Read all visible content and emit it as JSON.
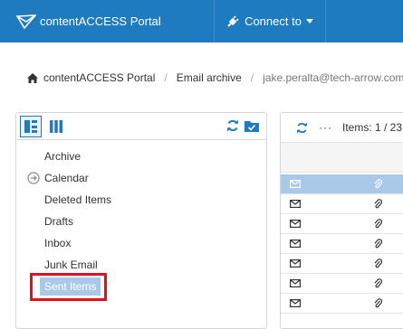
{
  "header": {
    "brand": "contentACCESS Portal",
    "connect_label": "Connect to",
    "brand_color": "#1f7bbf"
  },
  "breadcrumb": {
    "items": [
      "contentACCESS Portal",
      "Email archive",
      "jake.peralta@tech-arrow.com"
    ]
  },
  "folders": {
    "items": [
      {
        "label": "Archive",
        "expandable": false
      },
      {
        "label": "Calendar",
        "expandable": true
      },
      {
        "label": "Deleted Items",
        "expandable": false
      },
      {
        "label": "Drafts",
        "expandable": false
      },
      {
        "label": "Inbox",
        "expandable": false
      },
      {
        "label": "Junk Email",
        "expandable": false
      },
      {
        "label": "Sent Items",
        "expandable": false,
        "selected": true
      }
    ],
    "selected_color": "#aac9e8",
    "highlight_color": "#e0101e"
  },
  "mail": {
    "items_label": "Items: 1 / 23",
    "more_label": "···"
  },
  "icons": [
    "logo-icon",
    "plug-icon",
    "caret-down-icon",
    "home-icon",
    "tree-view-icon",
    "column-view-icon",
    "refresh-icon",
    "folder-check-icon",
    "circle-arrow-icon",
    "envelope-icon",
    "paperclip-icon"
  ]
}
